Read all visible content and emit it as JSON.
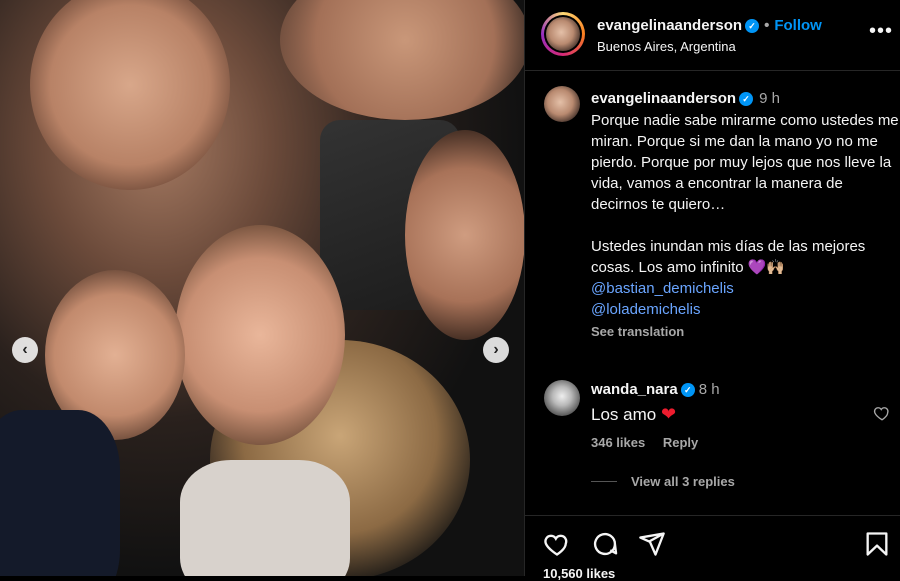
{
  "post": {
    "username": "evangelinaanderson",
    "verified_mark": "✓",
    "separator": "•",
    "follow_label": "Follow",
    "location": "Buenos Aires, Argentina",
    "more_label": "•••"
  },
  "caption": {
    "username": "evangelinaanderson",
    "time": "9 h",
    "text": "Porque nadie sabe mirarme como ustedes me miran. Porque si me dan la mano yo no me pierdo. Porque por muy lejos que nos lleve la vida, vamos a encontrar la manera de decirnos te quiero…\n\nUstedes inundan mis días de las mejores cosas. Los amo infinito 💜🙌🏼",
    "mentions": [
      "@bastian_demichelis",
      "@lolademichelis"
    ],
    "see_translation": "See translation"
  },
  "comment": {
    "username": "wanda_nara",
    "time": "8 h",
    "text": "Los amo",
    "emoji": "❤",
    "likes": "346 likes",
    "reply_label": "Reply",
    "view_replies": "View all 3 replies"
  },
  "carousel": {
    "prev_label": "‹",
    "next_label": "›"
  },
  "likes_partial": "10,560 likes",
  "icons": [
    "heart-icon",
    "comment-icon",
    "share-icon",
    "save-icon",
    "more-icon",
    "verified-icon"
  ],
  "colors": {
    "background": "#000000",
    "text": "#f5f5f5",
    "muted": "#a8a8a8",
    "link": "#0095f6",
    "mention": "#6aa5ff"
  }
}
